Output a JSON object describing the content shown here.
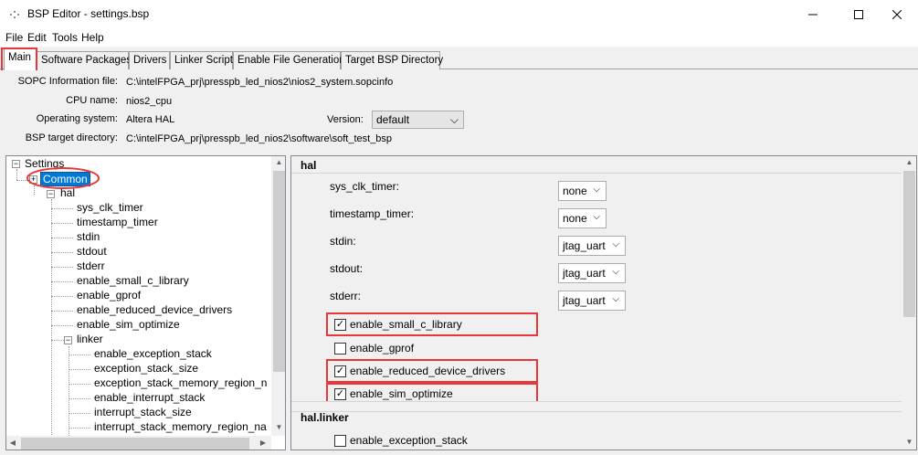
{
  "window": {
    "title": "BSP Editor - settings.bsp",
    "minimize_glyph": "—",
    "maximize_glyph": "☐",
    "close_glyph": "✕"
  },
  "menu": [
    "File",
    "Edit",
    "Tools",
    "Help"
  ],
  "tabs": [
    "Main",
    "Software Packages",
    "Drivers",
    "Linker Script",
    "Enable File Generation",
    "Target BSP Directory"
  ],
  "info": {
    "sopc_label": "SOPC Information file:",
    "sopc_value": "C:\\intelFPGA_prj\\presspb_led_nios2\\nios2_system.sopcinfo",
    "cpu_label": "CPU name:",
    "cpu_value": "nios2_cpu",
    "os_label": "Operating system:",
    "os_value": "Altera HAL",
    "version_label": "Version:",
    "version_value": "default",
    "bsp_label": "BSP target directory:",
    "bsp_value": "C:\\intelFPGA_prj\\presspb_led_nios2\\software\\soft_test_bsp"
  },
  "tree": {
    "settings": "Settings",
    "common": "Common",
    "hal": "hal",
    "hal_children": [
      "sys_clk_timer",
      "timestamp_timer",
      "stdin",
      "stdout",
      "stderr",
      "enable_small_c_library",
      "enable_gprof",
      "enable_reduced_device_drivers",
      "enable_sim_optimize"
    ],
    "linker": "linker",
    "linker_children": [
      "enable_exception_stack",
      "exception_stack_size",
      "exception_stack_memory_region_n",
      "enable_interrupt_stack",
      "interrupt_stack_size",
      "interrupt_stack_memory_region_na"
    ]
  },
  "panel": {
    "hal_header": "hal",
    "settings": [
      {
        "label": "sys_clk_timer:",
        "value": "none"
      },
      {
        "label": "timestamp_timer:",
        "value": "none"
      },
      {
        "label": "stdin:",
        "value": "jtag_uart"
      },
      {
        "label": "stdout:",
        "value": "jtag_uart"
      },
      {
        "label": "stderr:",
        "value": "jtag_uart"
      }
    ],
    "checks": [
      {
        "label": "enable_small_c_library",
        "checked": true
      },
      {
        "label": "enable_gprof",
        "checked": false
      },
      {
        "label": "enable_reduced_device_drivers",
        "checked": true
      },
      {
        "label": "enable_sim_optimize",
        "checked": true
      }
    ],
    "linker_header": "hal.linker",
    "linker_checks": [
      {
        "label": "enable_exception_stack",
        "checked": false
      }
    ]
  },
  "glyphs": {
    "check": "✓",
    "chevron": "⌵",
    "expander_minus": "−",
    "expander_plus": "+"
  },
  "colors": {
    "highlight": "#e8373a",
    "selection": "#0078d7"
  }
}
